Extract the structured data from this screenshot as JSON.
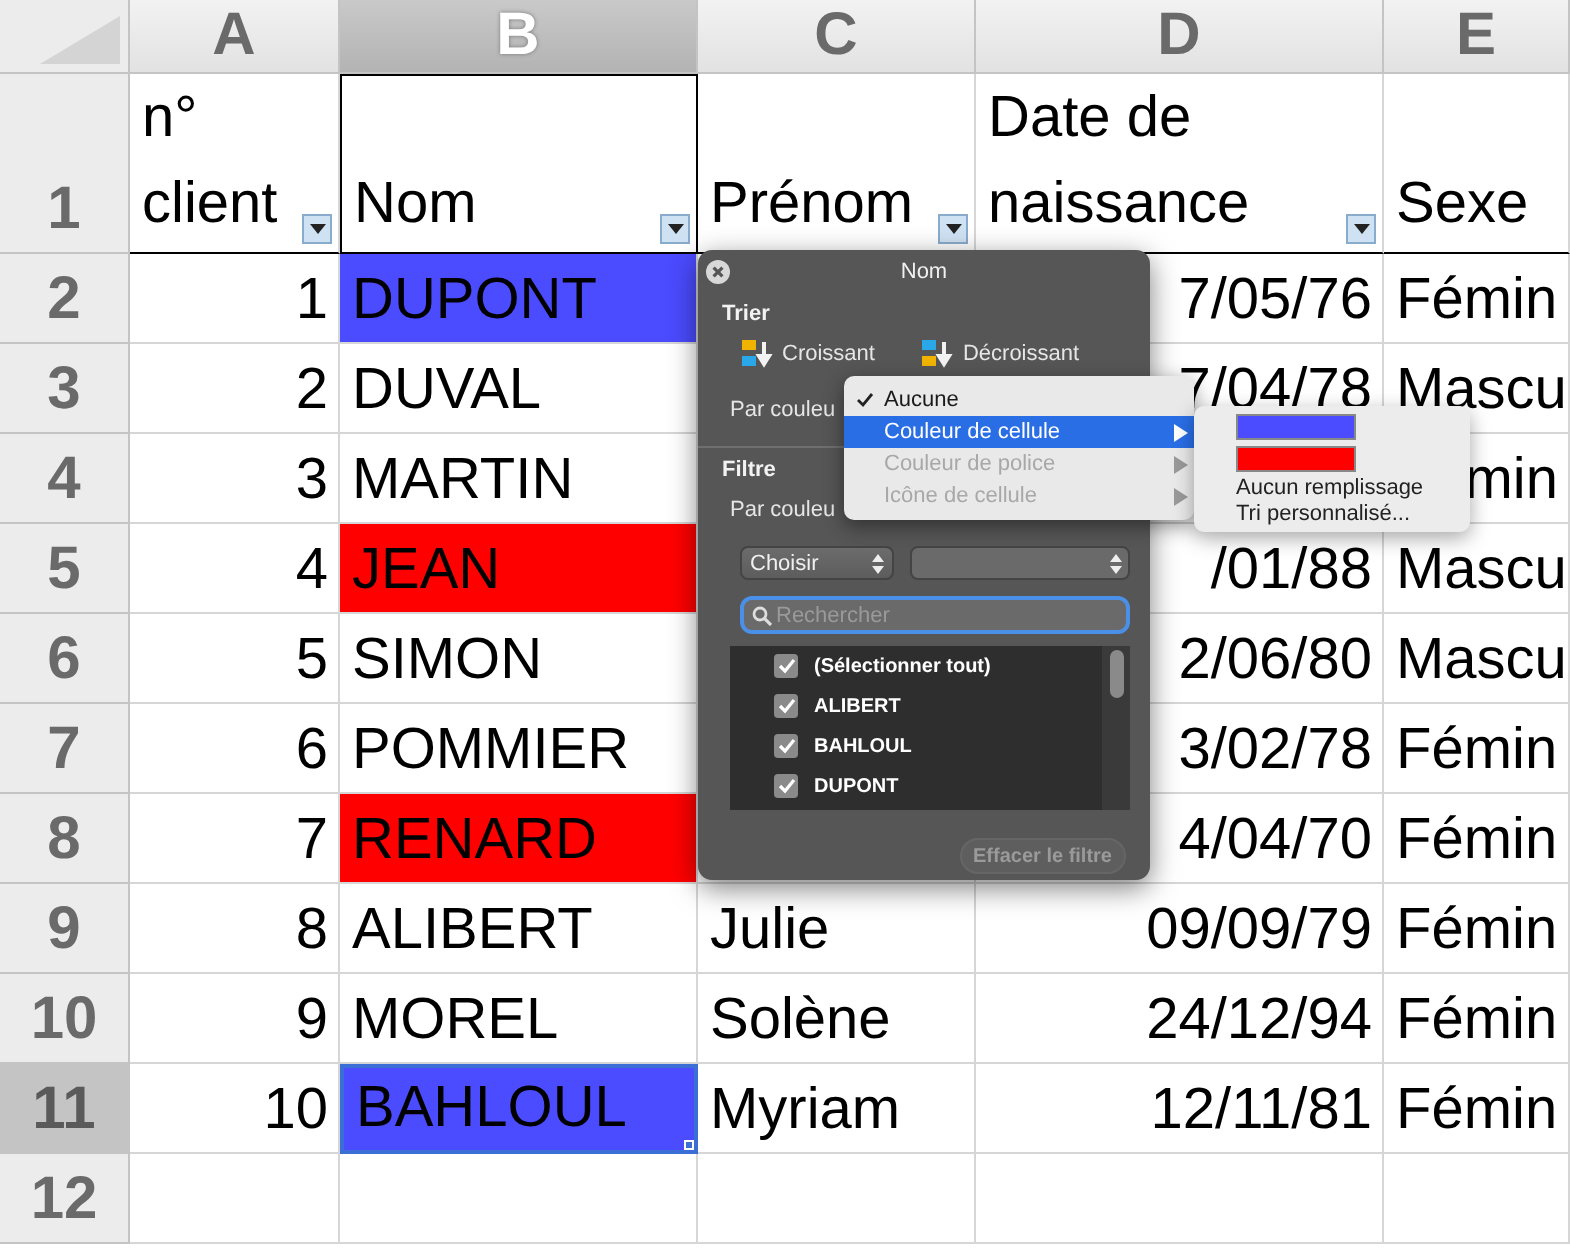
{
  "columns": [
    {
      "label": "A",
      "selected": false
    },
    {
      "label": "B",
      "selected": true
    },
    {
      "label": "C",
      "selected": false
    },
    {
      "label": "D",
      "selected": false
    },
    {
      "label": "E",
      "selected": false
    }
  ],
  "header_row": {
    "label": "1",
    "selected": false,
    "cells": [
      {
        "text": "n°\nclient",
        "filter": true
      },
      {
        "text": "Nom",
        "filter": true
      },
      {
        "text": "Prénom",
        "filter": true
      },
      {
        "text": "Date de\nnaissance",
        "filter": true
      },
      {
        "text": "Sexe",
        "filter": false
      }
    ]
  },
  "rows": [
    {
      "label": "2",
      "selected": false,
      "client": "1",
      "nom": {
        "text": "DUPONT",
        "color": "#4b4bff"
      },
      "date": "7/05/76",
      "sexe": "Fémin"
    },
    {
      "label": "3",
      "selected": false,
      "client": "2",
      "nom": {
        "text": "DUVAL"
      },
      "date": "7/04/78",
      "sexe": "Mascu"
    },
    {
      "label": "4",
      "selected": false,
      "client": "3",
      "nom": {
        "text": "MARTIN"
      },
      "sexe": "min",
      "sexe_cut": true
    },
    {
      "label": "5",
      "selected": false,
      "client": "4",
      "nom": {
        "text": "JEAN",
        "color": "#ff0000"
      },
      "date": "/01/88",
      "sexe": "Mascu"
    },
    {
      "label": "6",
      "selected": false,
      "client": "5",
      "nom": {
        "text": "SIMON"
      },
      "date": "2/06/80",
      "sexe": "Mascu"
    },
    {
      "label": "7",
      "selected": false,
      "client": "6",
      "nom": {
        "text": "POMMIER"
      },
      "date": "3/02/78",
      "sexe": "Fémin"
    },
    {
      "label": "8",
      "selected": false,
      "client": "7",
      "nom": {
        "text": "RENARD",
        "color": "#ff0000"
      },
      "date": "4/04/70",
      "sexe": "Fémin"
    },
    {
      "label": "9",
      "selected": false,
      "client": "8",
      "nom": {
        "text": "ALIBERT"
      },
      "prenom": "Julie",
      "date": "09/09/79",
      "sexe": "Fémin"
    },
    {
      "label": "10",
      "selected": false,
      "client": "9",
      "nom": {
        "text": "MOREL"
      },
      "prenom": "Solène",
      "date": "24/12/94",
      "sexe": "Fémin"
    },
    {
      "label": "11",
      "selected": true,
      "client": "10",
      "nom": {
        "text": "BAHLOUL",
        "color": "#4b4bff"
      },
      "prenom": "Myriam",
      "date": "12/11/81",
      "sexe": "Fémin"
    },
    {
      "label": "12",
      "selected": false
    }
  ],
  "filter_popup": {
    "title": "Nom",
    "sort_heading": "Trier",
    "ascending": "Croissant",
    "descending": "Décroissant",
    "sort_by_color": "Par couleu",
    "filter_heading": "Filtre",
    "filter_by_color": "Par couleu",
    "condition": "Choisir",
    "search": {
      "placeholder": "Rechercher"
    },
    "items": [
      {
        "label": "(Sélectionner tout)",
        "checked": true
      },
      {
        "label": "ALIBERT",
        "checked": true
      },
      {
        "label": "BAHLOUL",
        "checked": true
      },
      {
        "label": "DUPONT",
        "checked": true
      }
    ],
    "clear_button": {
      "label": "Effacer le filtre",
      "disabled": true
    }
  },
  "color_menu": {
    "items": [
      {
        "label": "Aucune",
        "checked": true,
        "highlighted": false,
        "disabled": false,
        "submenu": false
      },
      {
        "label": "Couleur de cellule",
        "checked": false,
        "highlighted": true,
        "disabled": false,
        "submenu": true
      },
      {
        "label": "Couleur de police",
        "checked": false,
        "highlighted": false,
        "disabled": true,
        "submenu": true
      },
      {
        "label": "Icône de cellule",
        "checked": false,
        "highlighted": false,
        "disabled": true,
        "submenu": true
      }
    ]
  },
  "color_submenu": {
    "items": [
      {
        "kind": "swatch",
        "color": "#4b4bff"
      },
      {
        "kind": "swatch",
        "color": "#ff0000"
      },
      {
        "kind": "text",
        "label": "Aucun remplissage"
      },
      {
        "kind": "text",
        "label": "Tri personnalisé..."
      }
    ]
  }
}
